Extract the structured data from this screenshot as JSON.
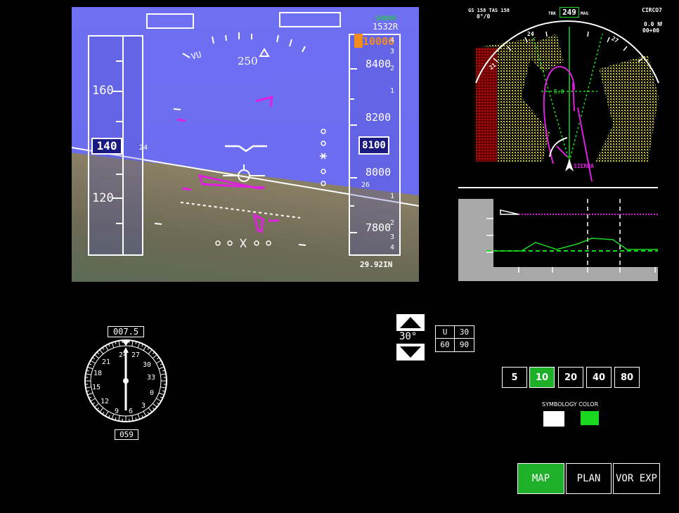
{
  "pfd": {
    "speed_ticks": [
      "160",
      "120"
    ],
    "speed_current": "140",
    "speed_trend_small": "24",
    "altitude_selected": "10000",
    "altitude_top_green": "SH800",
    "altitude_top_runway": "1532R",
    "altitude_ticks": [
      "8400",
      "8200",
      "8000",
      "7800"
    ],
    "altitude_current": "8100",
    "vs_ticks_upper": [
      "4",
      "3",
      "2",
      "1"
    ],
    "vs_ticks_lower": [
      "1",
      "2",
      "3",
      "4"
    ],
    "heading_value": "250",
    "heading_letters": "VU",
    "horizon_label": "26",
    "baro_setting": "29.92IN"
  },
  "nd": {
    "gs_tas": "GS 158 TAS 158",
    "wind": "0°/0",
    "track_label": "TRK",
    "track_value": "249",
    "mag_label": "MAG",
    "procedure": "CIRCO7",
    "distance": "0.0 NM",
    "eta": "00+00",
    "compass_ticks": [
      "21",
      "24",
      "27"
    ],
    "range_ring": "5.0",
    "waypoint": "SIERRA"
  },
  "compass": {
    "top_readout": "007.5",
    "bottom_readout": "059",
    "numbers": [
      "24",
      "27",
      "30",
      "33",
      "0",
      "3",
      "6",
      "9",
      "12",
      "15",
      "18",
      "21"
    ]
  },
  "bank_control": {
    "value": "30°",
    "grid": [
      "U",
      "30",
      "60",
      "90"
    ]
  },
  "range_buttons": [
    "5",
    "10",
    "20",
    "40",
    "80"
  ],
  "range_active": "10",
  "symbology_label": "SYMBOLOGY COLOR",
  "colors": {
    "white_swatch": "#ffffff",
    "green_swatch": "#19d81f",
    "active_green": "#1fb02a"
  },
  "mode_buttons": [
    "MAP",
    "PLAN",
    "VOR EXP"
  ],
  "mode_active": "MAP"
}
